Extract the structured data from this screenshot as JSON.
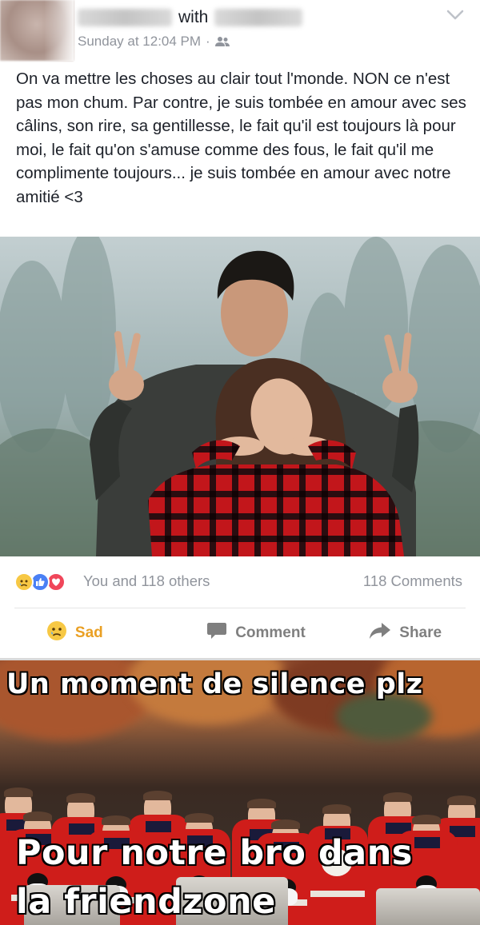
{
  "post": {
    "header": {
      "with_word": "with",
      "timestamp": "Sunday at 12:04 PM",
      "separator": "·",
      "audience_icon": "friends-icon",
      "menu_icon": "chevron-down-icon"
    },
    "text": "On va mettre les choses au clair tout l'monde. NON ce n'est pas mon chum. Par contre, je suis tombée en amour avec ses câlins, son rire, sa gentillesse, le fait qu'il est toujours là pour moi, le fait qu'on s'amuse comme des fous, le fait qu'il me complimente toujours... je suis tombée en amour avec notre amitié <3",
    "reactions": {
      "icons": [
        "sad-reaction-icon",
        "like-reaction-icon",
        "love-reaction-icon"
      ],
      "summary": "You and 118 others",
      "comments": "118 Comments"
    },
    "actions": {
      "sad": "Sad",
      "comment": "Comment",
      "share": "Share"
    }
  },
  "meme": {
    "top_text": "Un moment de silence plz",
    "bottom_line1": "Pour notre bro dans",
    "bottom_line2": "la friendzone"
  },
  "colors": {
    "sad_accent": "#eaa024",
    "meta_gray": "#90949c",
    "like_blue": "#4a80f5",
    "love_red": "#f0465a",
    "uniform_red": "#cf1d1a"
  }
}
